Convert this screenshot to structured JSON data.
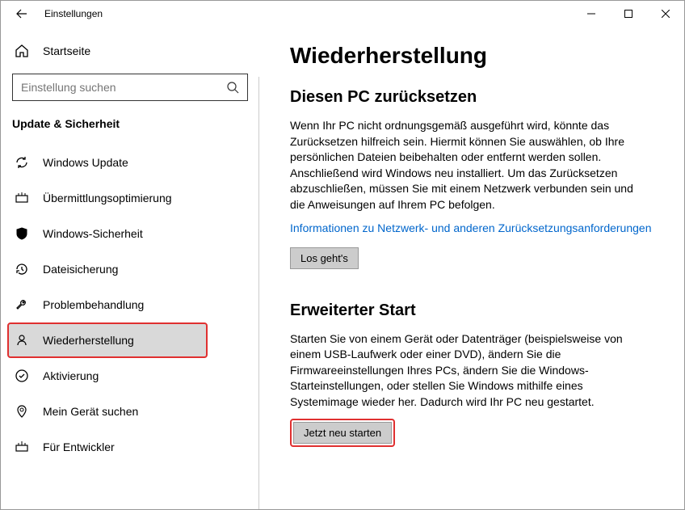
{
  "titlebar": {
    "title": "Einstellungen"
  },
  "sidebar": {
    "home_label": "Startseite",
    "search_placeholder": "Einstellung suchen",
    "section_header": "Update & Sicherheit",
    "items": [
      {
        "label": "Windows Update"
      },
      {
        "label": "Übermittlungsoptimierung"
      },
      {
        "label": "Windows-Sicherheit"
      },
      {
        "label": "Dateisicherung"
      },
      {
        "label": "Problembehandlung"
      },
      {
        "label": "Wiederherstellung"
      },
      {
        "label": "Aktivierung"
      },
      {
        "label": "Mein Gerät suchen"
      },
      {
        "label": "Für Entwickler"
      }
    ]
  },
  "main": {
    "heading": "Wiederherstellung",
    "reset": {
      "title": "Diesen PC zurücksetzen",
      "body": "Wenn Ihr PC nicht ordnungsgemäß ausgeführt wird, könnte das Zurücksetzen hilfreich sein. Hiermit können Sie auswählen, ob Ihre persönlichen Dateien beibehalten oder entfernt werden sollen. Anschließend wird Windows neu installiert. Um das Zurücksetzen abzuschließen, müssen Sie mit einem Netzwerk verbunden sein und die Anweisungen auf Ihrem PC befolgen.",
      "link": "Informationen zu Netzwerk- und anderen Zurücksetzungsanforderungen",
      "button": "Los geht's"
    },
    "advanced": {
      "title": "Erweiterter Start",
      "body": "Starten Sie von einem Gerät oder Datenträger (beispielsweise von einem USB-Laufwerk oder einer DVD), ändern Sie die Firmwareeinstellungen Ihres PCs, ändern Sie die Windows-Starteinstellungen, oder stellen Sie Windows mithilfe eines Systemimage wieder her. Dadurch wird Ihr PC neu gestartet.",
      "button": "Jetzt neu starten"
    }
  }
}
